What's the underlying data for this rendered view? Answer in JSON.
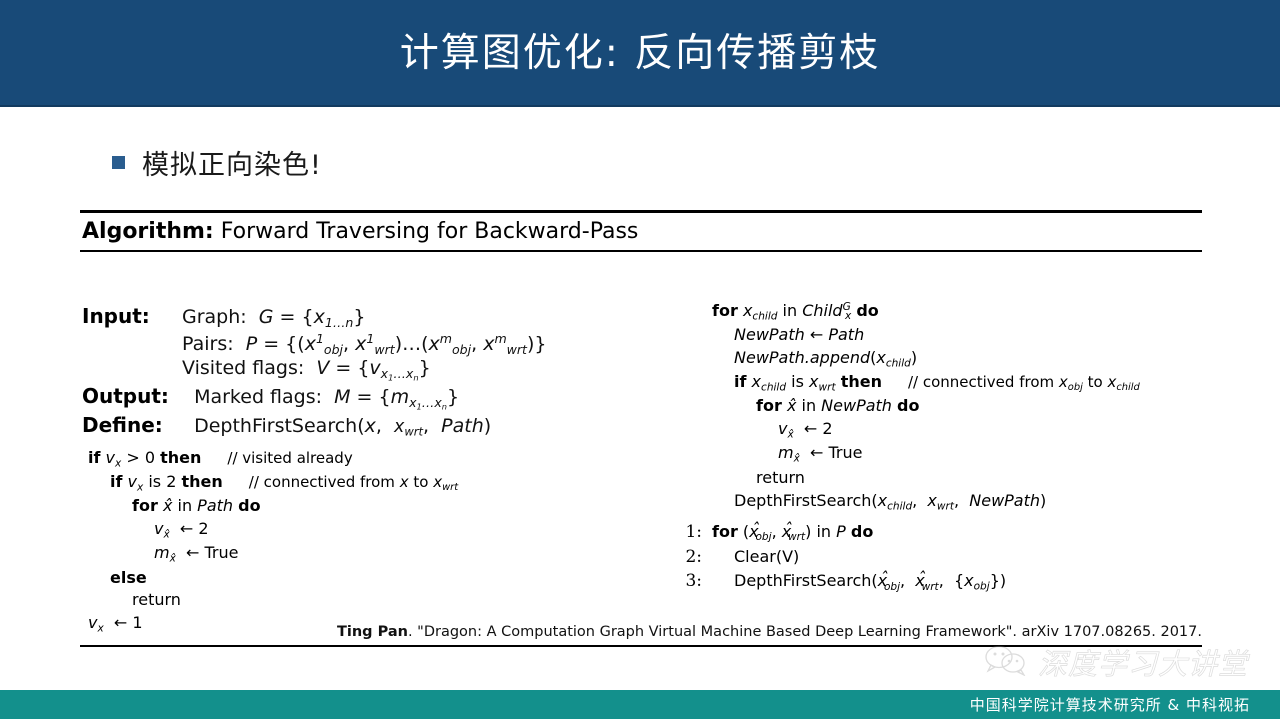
{
  "slide": {
    "title": "计算图优化: 反向传播剪枝",
    "header_color": "#184a78",
    "bullet": "模拟正向染色!",
    "bullet_color": "#2a5d8f"
  },
  "algorithm": {
    "label": "Algorithm:",
    "name": "Forward Traversing for Backward-Pass",
    "io": [
      {
        "label": "Input:",
        "lines": [
          "Graph:  G = {x1…n}",
          "Pairs:  P = {(x¹obj, x¹wrt)…(xᵐobj, xᵐwrt)}",
          "Visited flags:  V = {vx1…xn}"
        ]
      },
      {
        "label": "Output:",
        "lines": [
          "Marked flags:  M = {mx1…xn}"
        ]
      },
      {
        "label": "Define:",
        "lines": [
          "DepthFirstSearch(x,  xwrt,  Path)"
        ]
      }
    ],
    "left_column": [
      {
        "indent": 0,
        "code": "if vx > 0 then",
        "comment": "// visited already"
      },
      {
        "indent": 1,
        "code": "if vx is 2 then",
        "comment": "// connectived from x to xwrt"
      },
      {
        "indent": 2,
        "code": "for x̂ in Path do",
        "comment": ""
      },
      {
        "indent": 3,
        "code": "vx̂ ← 2",
        "comment": ""
      },
      {
        "indent": 3,
        "code": "mx̂ ← True",
        "comment": ""
      },
      {
        "indent": 1,
        "code": "else",
        "comment": ""
      },
      {
        "indent": 2,
        "code": "return",
        "comment": ""
      },
      {
        "indent": 0,
        "code": "vx ← 1",
        "comment": ""
      }
    ],
    "right_column": [
      {
        "num": "",
        "indent": 0,
        "code": "for xchild in ChildGx do",
        "comment": ""
      },
      {
        "num": "",
        "indent": 1,
        "code": "NewPath ← Path",
        "comment": ""
      },
      {
        "num": "",
        "indent": 1,
        "code": "NewPath.append(xchild)",
        "comment": ""
      },
      {
        "num": "",
        "indent": 1,
        "code": "if xchild is xwrt then",
        "comment": "// connectived from xobj to xchild"
      },
      {
        "num": "",
        "indent": 2,
        "code": "for x̂ in NewPath do",
        "comment": ""
      },
      {
        "num": "",
        "indent": 3,
        "code": "vx̂ ← 2",
        "comment": ""
      },
      {
        "num": "",
        "indent": 3,
        "code": "mx̂ ← True",
        "comment": ""
      },
      {
        "num": "",
        "indent": 2,
        "code": "return",
        "comment": ""
      },
      {
        "num": "",
        "indent": 1,
        "code": "DepthFirstSearch(xchild, xwrt, NewPath)",
        "comment": ""
      },
      {
        "num": "1:",
        "indent": 0,
        "code": "for (x̂obj, x̂wrt) in P do",
        "comment": ""
      },
      {
        "num": "2:",
        "indent": 1,
        "code": "Clear(V)",
        "comment": ""
      },
      {
        "num": "3:",
        "indent": 1,
        "code": "DepthFirstSearch(x̂obj, x̂wrt, {xobj})",
        "comment": ""
      }
    ]
  },
  "citation": {
    "author": "Ting Pan",
    "rest": ". \"Dragon: A Computation Graph Virtual Machine Based Deep Learning Framework\". arXiv 1707.08265. 2017."
  },
  "watermark": {
    "text": "深度学习大讲堂",
    "icon": "wechat-icon"
  },
  "footer": {
    "text": "中国科学院计算技术研究所 & 中科视拓",
    "color": "#13908c"
  }
}
